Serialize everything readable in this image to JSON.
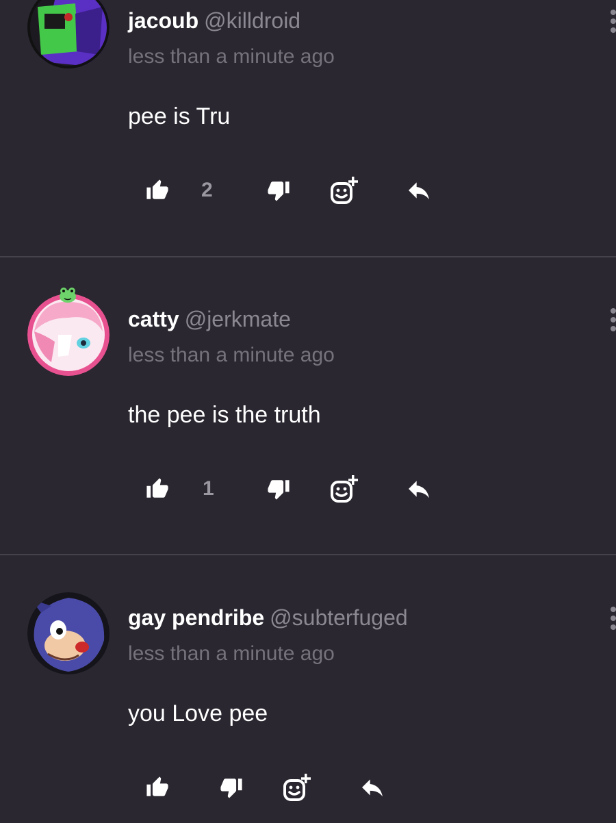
{
  "comments": [
    {
      "display_name": "jacoub",
      "handle": "@killdroid",
      "time": "less than a minute ago",
      "text": "pee is Tru",
      "likes": "2",
      "avatar_colors": [
        "#5a2fc4",
        "#44c84a",
        "#1a1a1a"
      ]
    },
    {
      "display_name": "catty",
      "handle": "@jerkmate",
      "time": "less than a minute ago",
      "text": "the pee is the truth",
      "likes": "1",
      "avatar_colors": [
        "#e8518f",
        "#f6a9c8",
        "#62d1e0"
      ]
    },
    {
      "display_name": "gay pendribe",
      "handle": "@subterfuged",
      "time": "less than a minute ago",
      "text": "you Love pee",
      "likes": "",
      "avatar_colors": [
        "#4a4ba8",
        "#f1c9a5",
        "#cc2a2a"
      ]
    }
  ],
  "colors": {
    "background": "#2a2730",
    "divider": "#45424b",
    "muted_text": "#75727c",
    "handle_text": "#8b8892",
    "icon": "#ffffff"
  }
}
